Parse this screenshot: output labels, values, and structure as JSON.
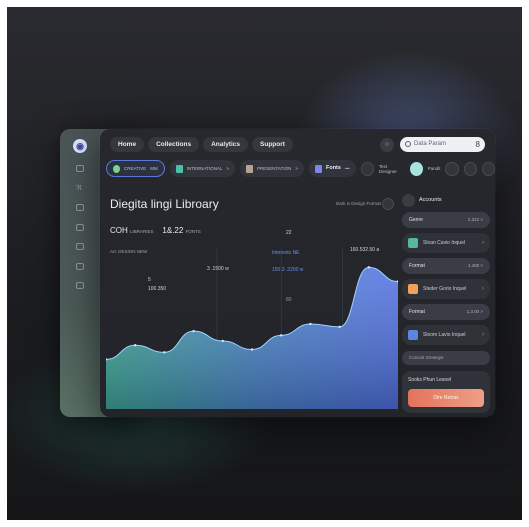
{
  "nav": {
    "items": [
      "Home",
      "Collections",
      "Analytics",
      "Support"
    ],
    "search_placeholder": "Data Param",
    "account_icon": "8"
  },
  "chips": [
    {
      "label": "CREATIVE",
      "sub": "MM",
      "color": "#7bd389"
    },
    {
      "label": "INTERNATIONAL",
      "sub": ">",
      "color": "#4bbfa9"
    },
    {
      "label": "PRESENTATION",
      "sub": ">",
      "color": "#b8a48f"
    },
    {
      "label": "Fonts",
      "sub": "•••",
      "color": "#7c87e6"
    }
  ],
  "user": {
    "label": "Text Designer",
    "name": "Pandit"
  },
  "main": {
    "title": "Diegita lingi Libroary",
    "sort_label": "Dark is Design Format",
    "stat1": "COH",
    "stat1_small": "LIBRARIES",
    "stat2": "1&.22",
    "stat2_small": "FONTS",
    "sublabel": "Art. DESIGN NEW",
    "annotations": {
      "a1": "22",
      "a2": "3 .1500 w",
      "a3": "Interests NE",
      "a4": "160.532.50 a",
      "a5": "5",
      "a6": "100.350",
      "a7": "150.3 .3200 w",
      "a8": "80"
    }
  },
  "right": {
    "header": "Accounts",
    "rows": [
      {
        "label": "Genre",
        "value": "2,322 >"
      },
      {
        "label": "Format",
        "value": "1.400 >"
      },
      {
        "label": "Format",
        "value": "1.3.00 >"
      }
    ],
    "items": [
      {
        "label": "Sloan Cavio Inquel",
        "color": "#57b79d"
      },
      {
        "label": "Steder Gorio Inquel",
        "color": "#f0a15a"
      },
      {
        "label": "Sloom Lavio Inquel",
        "color": "#5b84e3"
      }
    ],
    "input": "Consult Strategie",
    "card_title": "Sooks Phun Lesoel",
    "card_button": "Dire Retrax"
  },
  "chart_data": {
    "type": "area",
    "x": [
      0,
      1,
      2,
      3,
      4,
      5,
      6,
      7,
      8,
      9,
      10
    ],
    "series": [
      {
        "values": [
          35,
          45,
          40,
          55,
          48,
          42,
          52,
          60,
          58,
          100,
          90
        ]
      }
    ],
    "ylim": [
      0,
      120
    ]
  }
}
